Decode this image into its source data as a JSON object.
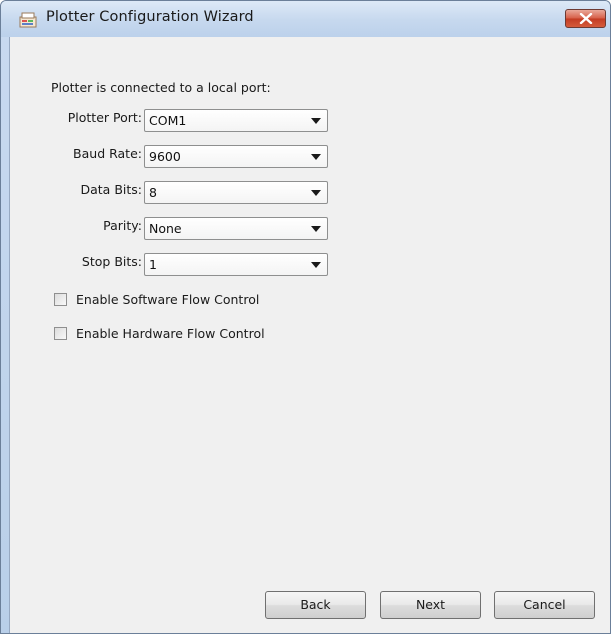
{
  "window": {
    "title": "Plotter Configuration Wizard"
  },
  "form": {
    "heading": "Plotter is connected to a local port:",
    "fields": [
      {
        "label": "Plotter Port:",
        "value": "COM1"
      },
      {
        "label": "Baud Rate:",
        "value": "9600"
      },
      {
        "label": "Data Bits:",
        "value": "8"
      },
      {
        "label": "Parity:",
        "value": "None"
      },
      {
        "label": "Stop Bits:",
        "value": "1"
      }
    ],
    "checkboxes": [
      {
        "label": "Enable Software Flow Control",
        "checked": false
      },
      {
        "label": "Enable Hardware Flow Control",
        "checked": false
      }
    ]
  },
  "buttons": {
    "back": "Back",
    "next": "Next",
    "cancel": "Cancel"
  },
  "icons": {
    "app": "plotter-app-icon",
    "close": "close-icon",
    "dropdown": "chevron-down-icon"
  },
  "colors": {
    "titlebar": "#c6d8ee",
    "close_button": "#c33c23",
    "dialog_background": "#f0f0f0"
  }
}
